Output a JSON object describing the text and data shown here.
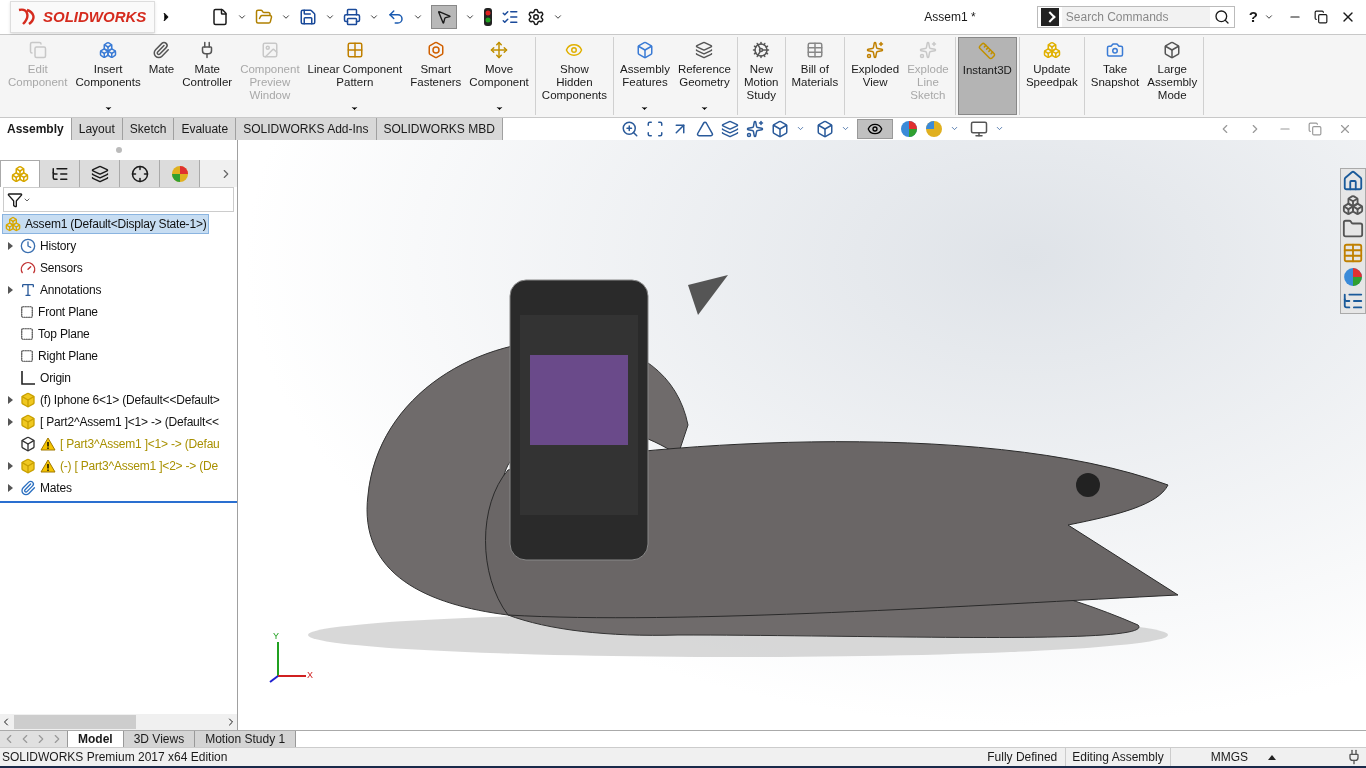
{
  "window": {
    "title": "Assem1 *"
  },
  "logo": {
    "text": "SOLIDWORKS"
  },
  "search": {
    "placeholder": "Search Commands"
  },
  "help": {
    "label": "?"
  },
  "ribbon": {
    "groups": [
      [
        {
          "label": "Edit\nComponent",
          "disabled": true,
          "on": false,
          "dropdown": false
        },
        {
          "label": "Insert\nComponents",
          "disabled": false,
          "on": false,
          "dropdown": true
        },
        {
          "label": "Mate",
          "disabled": false,
          "on": false,
          "dropdown": false
        },
        {
          "label": "Mate\nController",
          "disabled": false,
          "on": false,
          "dropdown": false
        },
        {
          "label": "Component\nPreview\nWindow",
          "disabled": true,
          "on": false,
          "dropdown": false
        },
        {
          "label": "Linear Component\nPattern",
          "disabled": false,
          "on": false,
          "dropdown": true
        },
        {
          "label": "Smart\nFasteners",
          "disabled": false,
          "on": false,
          "dropdown": false
        },
        {
          "label": "Move\nComponent",
          "disabled": false,
          "on": false,
          "dropdown": true
        }
      ],
      [
        {
          "label": "Show\nHidden\nComponents",
          "disabled": false,
          "on": false,
          "dropdown": false
        }
      ],
      [
        {
          "label": "Assembly\nFeatures",
          "disabled": false,
          "on": false,
          "dropdown": true
        },
        {
          "label": "Reference\nGeometry",
          "disabled": false,
          "on": false,
          "dropdown": true
        }
      ],
      [
        {
          "label": "New\nMotion\nStudy",
          "disabled": false,
          "on": false,
          "dropdown": false
        }
      ],
      [
        {
          "label": "Bill of\nMaterials",
          "disabled": false,
          "on": false,
          "dropdown": false
        }
      ],
      [
        {
          "label": "Exploded\nView",
          "disabled": false,
          "on": false,
          "dropdown": false
        },
        {
          "label": "Explode\nLine\nSketch",
          "disabled": true,
          "on": false,
          "dropdown": false
        }
      ],
      [
        {
          "label": "Instant3D",
          "disabled": false,
          "on": true,
          "dropdown": false
        }
      ],
      [
        {
          "label": "Update\nSpeedpak",
          "disabled": false,
          "on": false,
          "dropdown": false
        }
      ],
      [
        {
          "label": "Take\nSnapshot",
          "disabled": false,
          "on": false,
          "dropdown": false
        },
        {
          "label": "Large\nAssembly\nMode",
          "disabled": false,
          "on": false,
          "dropdown": false
        }
      ]
    ]
  },
  "command_tabs": [
    {
      "label": "Assembly",
      "selected": true
    },
    {
      "label": "Layout",
      "selected": false
    },
    {
      "label": "Sketch",
      "selected": false
    },
    {
      "label": "Evaluate",
      "selected": false
    },
    {
      "label": "SOLIDWORKS Add-Ins",
      "selected": false
    },
    {
      "label": "SOLIDWORKS MBD",
      "selected": false
    }
  ],
  "tree": {
    "items": [
      {
        "kind": "assembly",
        "text": "Assem1  (Default<Display State-1>)",
        "selected": true,
        "expandable": false,
        "warning": false
      },
      {
        "kind": "history",
        "text": "History",
        "selected": false,
        "expandable": true,
        "warning": false
      },
      {
        "kind": "sensors",
        "text": "Sensors",
        "selected": false,
        "expandable": false,
        "warning": false
      },
      {
        "kind": "annotations",
        "text": "Annotations",
        "selected": false,
        "expandable": true,
        "warning": false
      },
      {
        "kind": "plane",
        "text": "Front Plane",
        "selected": false,
        "expandable": false,
        "warning": false
      },
      {
        "kind": "plane",
        "text": "Top Plane",
        "selected": false,
        "expandable": false,
        "warning": false
      },
      {
        "kind": "plane",
        "text": "Right Plane",
        "selected": false,
        "expandable": false,
        "warning": false
      },
      {
        "kind": "origin",
        "text": "Origin",
        "selected": false,
        "expandable": false,
        "warning": false
      },
      {
        "kind": "part",
        "text": "(f) Iphone 6<1> (Default<<Default>",
        "selected": false,
        "expandable": true,
        "warning": false
      },
      {
        "kind": "part",
        "text": "[ Part2^Assem1 ]<1> -> (Default<<",
        "selected": false,
        "expandable": true,
        "warning": false
      },
      {
        "kind": "part-outline",
        "text": "[ Part3^Assem1 ]<1> -> (Defau",
        "selected": false,
        "expandable": false,
        "warning": true
      },
      {
        "kind": "part",
        "text": "(-) [ Part3^Assem1 ]<2> -> (De",
        "selected": false,
        "expandable": true,
        "warning": true
      },
      {
        "kind": "mates",
        "text": "Mates",
        "selected": false,
        "expandable": true,
        "warning": false
      }
    ]
  },
  "triad": {
    "y": "Y",
    "x": "X"
  },
  "bottom_tabs": [
    {
      "label": "Model",
      "selected": true
    },
    {
      "label": "3D Views",
      "selected": false
    },
    {
      "label": "Motion Study 1",
      "selected": false
    }
  ],
  "status_bar": {
    "edition": "SOLIDWORKS Premium 2017 x64 Edition",
    "state": "Fully Defined",
    "mode": "Editing Assembly",
    "units": "MMGS"
  }
}
